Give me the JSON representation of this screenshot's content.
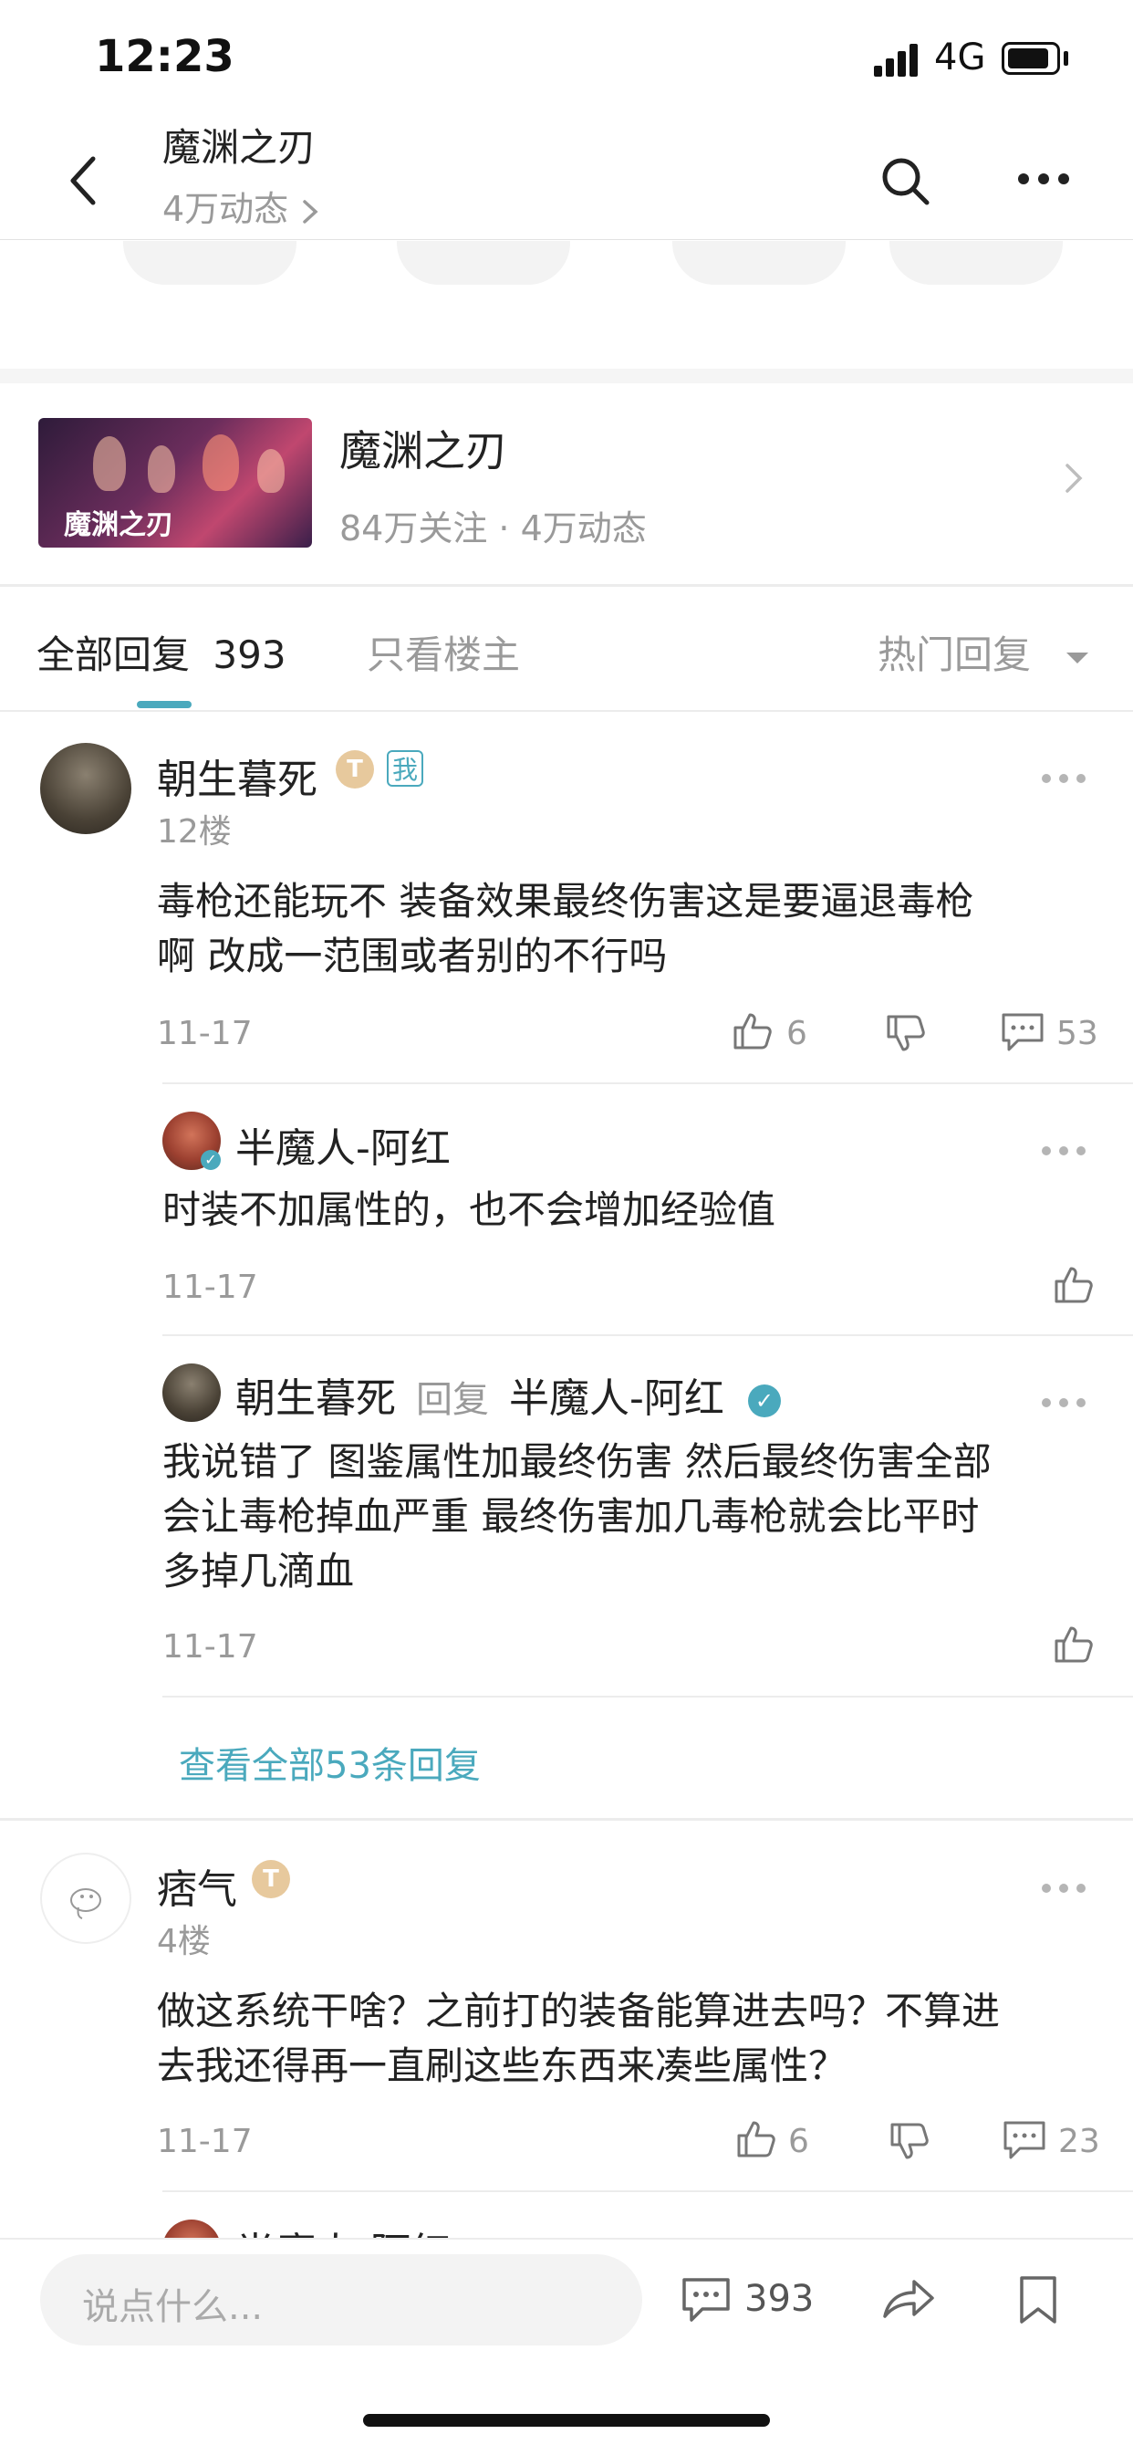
{
  "status": {
    "time": "12:23",
    "network": "4G"
  },
  "nav": {
    "title": "魔渊之刃",
    "subtitle": "4万动态",
    "back_icon": "chevron-left-icon",
    "search_icon": "search-icon",
    "more_icon": "more-icon"
  },
  "game": {
    "cover_text": "魔渊之刃",
    "name": "魔渊之刃",
    "stats": "84万关注 · 4万动态"
  },
  "tabs": {
    "all_label": "全部回复",
    "all_count": "393",
    "op_label": "只看楼主",
    "sort_label": "热门回复"
  },
  "posts": [
    {
      "name": "朝生暮死",
      "level": "T",
      "me_tag": "我",
      "floor": "12楼",
      "content_lines": [
        "毒枪还能玩不  装备效果最终伤害这是要逼退毒枪",
        "啊  改成一范围或者别的不行吗"
      ],
      "date": "11-17",
      "likes": "6",
      "comments": "53",
      "replies": [
        {
          "name": "半魔人-阿红",
          "content_lines": [
            "时装不加属性的，也不会增加经验值"
          ],
          "date": "11-17"
        },
        {
          "name": "朝生暮死",
          "reply_word": "回复",
          "reply_to": "半魔人-阿红",
          "content_lines": [
            "我说错了  图鉴属性加最终伤害  然后最终伤害全部",
            "会让毒枪掉血严重 最终伤害加几毒枪就会比平时",
            "多掉几滴血"
          ],
          "date": "11-17"
        }
      ],
      "view_all": "查看全部53条回复"
    },
    {
      "name": "痞气",
      "level": "T",
      "floor": "4楼",
      "content_lines": [
        "做这系统干啥？之前打的装备能算进去吗？不算进",
        "去我还得再一直刷这些东西来凑些属性？"
      ],
      "date": "11-17",
      "likes": "6",
      "comments": "23",
      "partial_reply_name": "半魔人-阿红"
    }
  ],
  "bottom": {
    "placeholder": "说点什么...",
    "comment_count": "393"
  },
  "colors": {
    "accent": "#4aa9bd",
    "text": "#222222",
    "muted": "#999999",
    "divider": "#ececec"
  }
}
